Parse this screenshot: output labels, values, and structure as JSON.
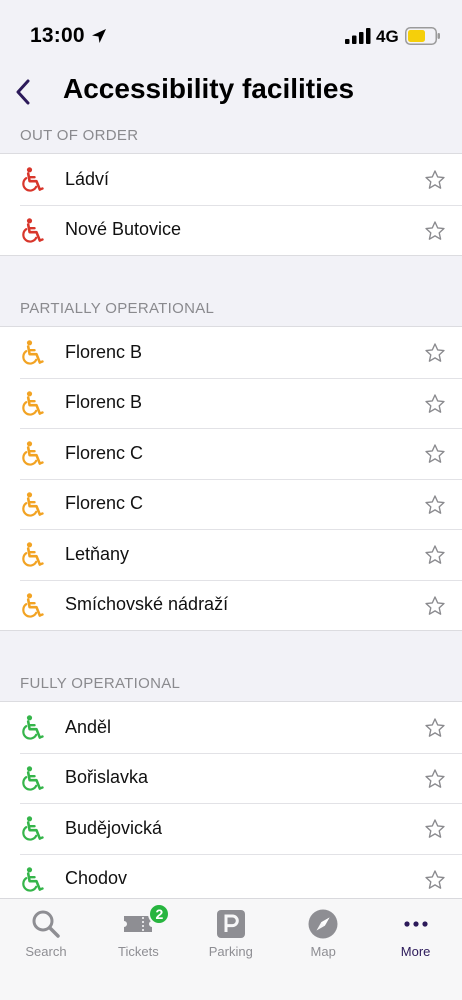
{
  "status": {
    "time": "13:00",
    "network": "4G"
  },
  "header": {
    "title": "Accessibility facilities"
  },
  "colors": {
    "out_of_order": "#d8362b",
    "partial": "#f2a323",
    "full": "#35b54a",
    "accent": "#2c1a5a"
  },
  "sections": [
    {
      "title": "OUT OF ORDER",
      "status": "out_of_order",
      "items": [
        "Ládví",
        "Nové Butovice"
      ]
    },
    {
      "title": "PARTIALLY OPERATIONAL",
      "status": "partial",
      "items": [
        "Florenc B",
        "Florenc B",
        "Florenc C",
        "Florenc C",
        "Letňany",
        "Smíchovské nádraží"
      ]
    },
    {
      "title": "FULLY OPERATIONAL",
      "status": "full",
      "items": [
        "Anděl",
        "Bořislavka",
        "Budějovická",
        "Chodov"
      ]
    }
  ],
  "tabs": [
    {
      "label": "Search",
      "icon": "search-icon"
    },
    {
      "label": "Tickets",
      "icon": "ticket-icon",
      "badge": "2"
    },
    {
      "label": "Parking",
      "icon": "parking-icon"
    },
    {
      "label": "Map",
      "icon": "compass-icon"
    },
    {
      "label": "More",
      "icon": "more-icon",
      "active": true
    }
  ]
}
